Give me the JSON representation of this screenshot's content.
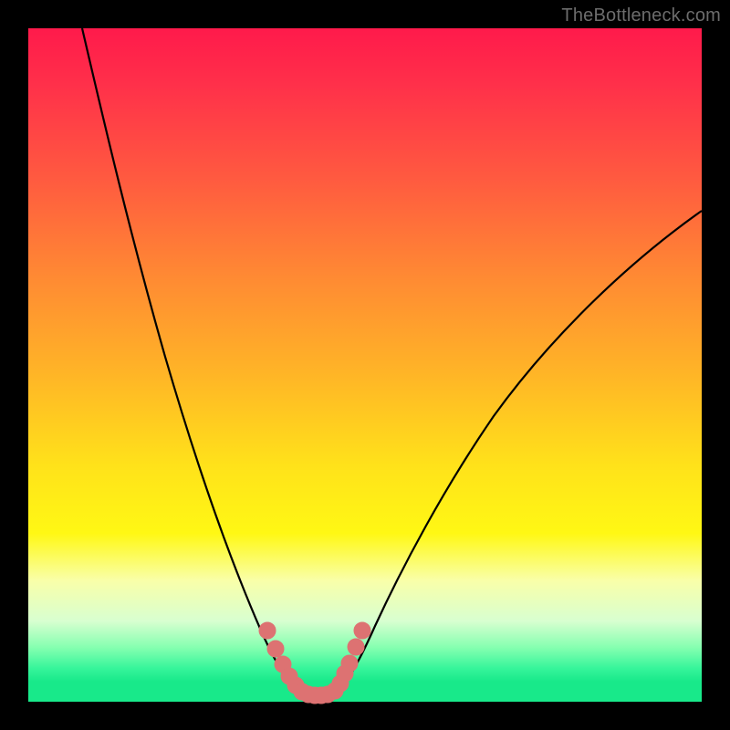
{
  "watermark": "TheBottleneck.com",
  "chart_data": {
    "type": "line",
    "title": "",
    "xlabel": "",
    "ylabel": "",
    "xlim": [
      0,
      100
    ],
    "ylim": [
      0,
      100
    ],
    "background_gradient": {
      "top": "#ff1a4b",
      "middle": "#ffe21a",
      "bottom": "#18e98a"
    },
    "series": [
      {
        "name": "left-curve",
        "stroke": "#000000",
        "stroke_width": 2,
        "points": [
          {
            "x": 8.0,
            "y": 100.0
          },
          {
            "x": 12.5,
            "y": 80.0
          },
          {
            "x": 17.0,
            "y": 63.0
          },
          {
            "x": 21.5,
            "y": 48.0
          },
          {
            "x": 26.0,
            "y": 35.0
          },
          {
            "x": 30.5,
            "y": 24.0
          },
          {
            "x": 34.0,
            "y": 15.0
          },
          {
            "x": 37.0,
            "y": 7.5
          },
          {
            "x": 39.5,
            "y": 3.0
          },
          {
            "x": 41.0,
            "y": 1.0
          }
        ]
      },
      {
        "name": "right-curve",
        "stroke": "#000000",
        "stroke_width": 2,
        "points": [
          {
            "x": 45.0,
            "y": 1.0
          },
          {
            "x": 47.0,
            "y": 3.0
          },
          {
            "x": 50.0,
            "y": 8.0
          },
          {
            "x": 55.0,
            "y": 18.0
          },
          {
            "x": 62.0,
            "y": 30.0
          },
          {
            "x": 70.0,
            "y": 42.0
          },
          {
            "x": 80.0,
            "y": 55.0
          },
          {
            "x": 90.0,
            "y": 65.0
          },
          {
            "x": 100.0,
            "y": 73.0
          }
        ]
      },
      {
        "name": "marker-blobs",
        "stroke": "#dd7272",
        "fill": "#dd7272",
        "type": "scatter",
        "points": [
          {
            "x": 35.5,
            "y": 10.5
          },
          {
            "x": 36.8,
            "y": 8.0
          },
          {
            "x": 37.8,
            "y": 5.5
          },
          {
            "x": 38.8,
            "y": 3.5
          },
          {
            "x": 39.7,
            "y": 2.2
          },
          {
            "x": 40.6,
            "y": 1.5
          },
          {
            "x": 41.5,
            "y": 1.2
          },
          {
            "x": 42.5,
            "y": 1.2
          },
          {
            "x": 43.5,
            "y": 1.3
          },
          {
            "x": 44.5,
            "y": 1.5
          },
          {
            "x": 45.5,
            "y": 2.0
          },
          {
            "x": 46.3,
            "y": 3.0
          },
          {
            "x": 47.0,
            "y": 4.5
          },
          {
            "x": 47.7,
            "y": 6.0
          },
          {
            "x": 48.7,
            "y": 8.5
          },
          {
            "x": 49.5,
            "y": 10.5
          }
        ]
      }
    ]
  }
}
